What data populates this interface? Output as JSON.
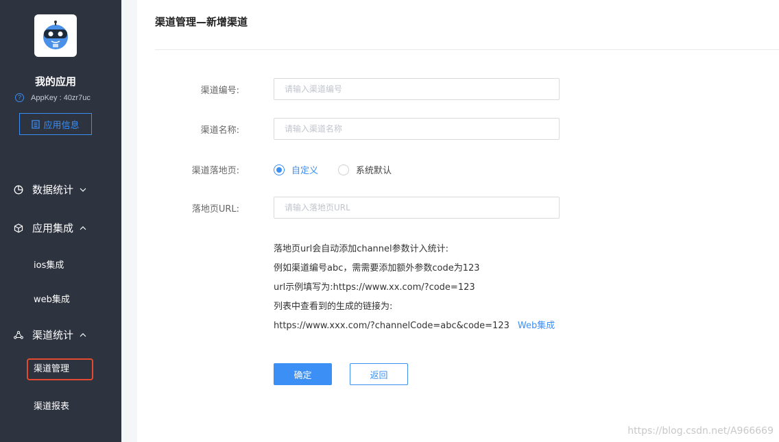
{
  "sidebar": {
    "app_name": "我的应用",
    "appkey": "AppKey : 40zr7uc",
    "info_button": "应用信息",
    "groups": [
      {
        "label": "数据统计",
        "icon": "pie-chart-icon",
        "expanded": false
      },
      {
        "label": "应用集成",
        "icon": "cube-icon",
        "expanded": true
      },
      {
        "label": "渠道统计",
        "icon": "share-nodes-icon",
        "expanded": true
      }
    ],
    "sub_items": {
      "ios": "ios集成",
      "web": "web集成",
      "channel_manage": "渠道管理",
      "channel_report": "渠道报表"
    }
  },
  "page": {
    "title": "渠道管理—新增渠道"
  },
  "form": {
    "code_label": "渠道编号:",
    "code_placeholder": "请输入渠道编号",
    "name_label": "渠道名称:",
    "name_placeholder": "请输入渠道名称",
    "landing_label": "渠道落地页:",
    "radio_custom": "自定义",
    "radio_default": "系统默认",
    "url_label": "落地页URL:",
    "url_placeholder": "请输入落地页URL"
  },
  "help": {
    "line1": "落地页url会自动添加channel参数计入统计:",
    "line2": "例如渠道编号abc，需需要添加额外参数code为123",
    "line3": "url示例填写为:https://www.xx.com/?code=123",
    "line4": "列表中查看到的生成的链接为:",
    "line5": "https://www.xxx.com/?channelCode=abc&code=123",
    "link": "Web集成"
  },
  "buttons": {
    "confirm": "确定",
    "back": "返回"
  },
  "watermark": "https://blog.csdn.net/A966669",
  "colors": {
    "sidebar_bg": "#2e3340",
    "accent": "#3b8ff5",
    "highlight": "#e64a2e"
  }
}
